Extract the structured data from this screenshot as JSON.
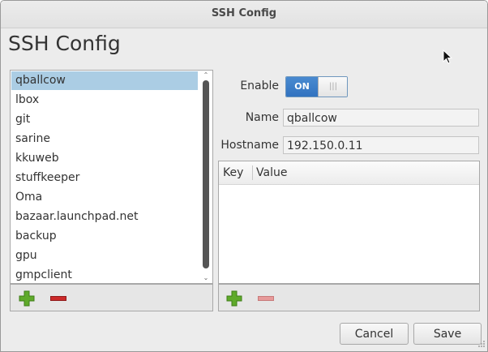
{
  "window": {
    "title": "SSH Config"
  },
  "heading": "SSH Config",
  "hosts": {
    "items": [
      "qballcow",
      "lbox",
      "git",
      "sarine",
      "kkuweb",
      "stuffkeeper",
      "Oma",
      "bazaar.launchpad.net",
      "backup",
      "gpu",
      "gmpclient"
    ],
    "selected_index": 0
  },
  "details": {
    "enable_label": "Enable",
    "enable_state": "ON",
    "name_label": "Name",
    "name_value": "qballcow",
    "hostname_label": "Hostname",
    "hostname_value": "192.150.0.11",
    "columns": {
      "key": "Key",
      "value": "Value"
    }
  },
  "buttons": {
    "cancel": "Cancel",
    "save": "Save"
  },
  "colors": {
    "selection": "#abcde4",
    "toggle_on": "#3a7cc6",
    "add_green": "#5faa2a",
    "remove_red": "#cc2a2a"
  },
  "icons": [
    "pointer-cursor-icon",
    "add-host-icon",
    "remove-host-icon",
    "add-option-icon",
    "remove-option-icon",
    "resize-grip-icon"
  ]
}
